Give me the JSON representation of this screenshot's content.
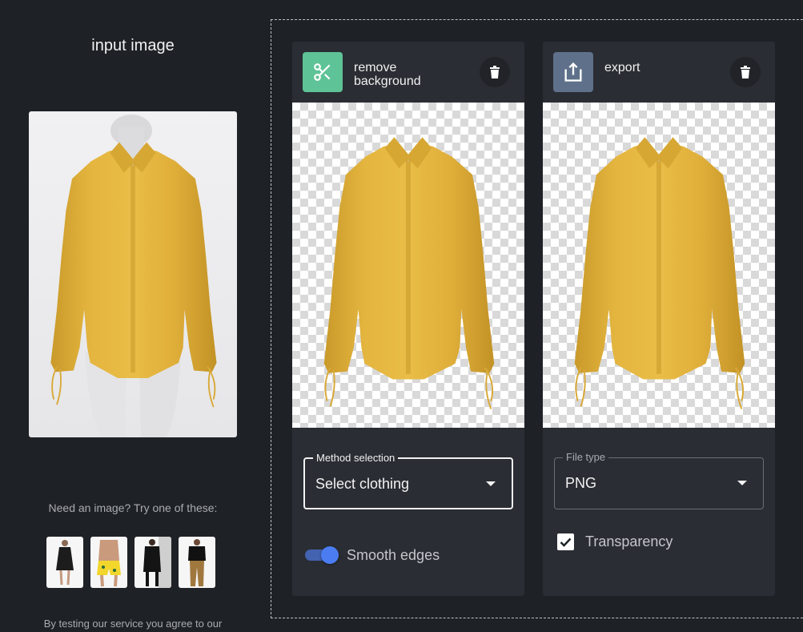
{
  "input_panel": {
    "title": "input image",
    "sample_prompt": "Need an image? Try one of these:",
    "terms_text": "By testing our service you agree to our"
  },
  "steps": [
    {
      "title": "remove background",
      "icon": "scissors-icon",
      "accent": "#5ec396",
      "field_label": "Method selection",
      "field_value": "Select clothing",
      "toggle_label": "Smooth edges",
      "toggle_on": true
    },
    {
      "title": "export",
      "icon": "export-icon",
      "accent": "#5f708a",
      "field_label": "File type",
      "field_value": "PNG",
      "checkbox_label": "Transparency",
      "checkbox_checked": true
    }
  ],
  "colors": {
    "background": "#1e2126",
    "card": "#2a2d33",
    "toggle_accent": "#4b7cf2",
    "shirt": "#e3b33c"
  }
}
